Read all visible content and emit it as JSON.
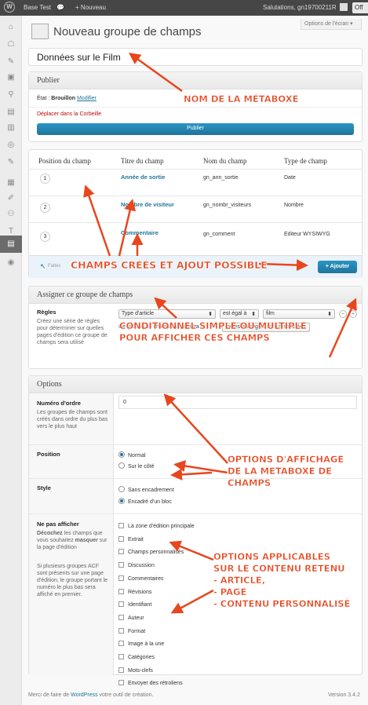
{
  "adminbar": {
    "site": "Base Test",
    "comments": "💬",
    "new": "+ Nouveau",
    "greeting": "Salutations, gn19700211R",
    "off": "Off"
  },
  "screen_options": "Options de l'écran ▾",
  "page_title": "Nouveau groupe de champs",
  "title_value": "Données sur le Film",
  "publish": {
    "heading": "Publier",
    "status_label": "État :",
    "status_value": "Brouillon",
    "edit_link": "Modifier",
    "trash": "Déplacer dans la Corbeille",
    "button": "Publier"
  },
  "fields": {
    "headers": [
      "Position du champ",
      "Titre du champ",
      "Nom du champ",
      "Type de champ"
    ],
    "rows": [
      {
        "pos": "1",
        "title": "Année de sortie",
        "name": "gn_ann_sortie",
        "type": "Date"
      },
      {
        "pos": "2",
        "title": "Nombre de visiteur",
        "name": "gn_nombr_visiteurs",
        "type": "Nombre"
      },
      {
        "pos": "3",
        "title": "Commentaire",
        "name": "gn_comment",
        "type": "Editeur WYSIWYG"
      }
    ],
    "hint": "Faites",
    "add_button": "+ Ajouter"
  },
  "location": {
    "heading": "Assigner ce groupe de champs",
    "rules_label": "Règles",
    "rules_desc": "Créez une série de règles pour déterminer sur quelles pages d'édition ce groupe de champs sera utilisé",
    "param": "Type d'article",
    "operator": "est égal à",
    "value": "film",
    "shown_if": "Ce groupe de champs apparaîtra si :",
    "match": "toutes les règles sont respectées"
  },
  "options": {
    "heading": "Options",
    "order_label": "Numéro d'ordre",
    "order_desc": "Les groupes de champs sont créés dans ordre du plus bas vers le plus haut",
    "order_value": "0",
    "position_label": "Position",
    "position_opts": [
      "Normal",
      "Sur le côté"
    ],
    "style_label": "Style",
    "style_opts": [
      "Sans encadrement",
      "Encadré d'un bloc"
    ],
    "hide_label": "Ne pas afficher",
    "hide_desc1a": "Décochez",
    "hide_desc1b": " les champs que vous souhaitez ",
    "hide_desc1c": "masquer",
    "hide_desc1d": " sur la page d'édition",
    "hide_desc2": "Si plusieurs groupes ACF sont présents sur une page d'édition, le groupe portant le numéro le plus bas sera affiché en premier.",
    "hide_items": [
      "La zone d'édition principale",
      "Extrait",
      "Champs personnalisés",
      "Discussion",
      "Commentaires",
      "Révisions",
      "Identifiant",
      "Auteur",
      "Format",
      "Image à la une",
      "Catégories",
      "Mots-clefs",
      "Envoyer des rétroliens"
    ]
  },
  "footer": {
    "prefix": "Merci de faire de ",
    "link": "WordPress",
    "suffix": " votre outil de création.",
    "version": "Version 3.4.2"
  },
  "annotations": {
    "a1": "NOM DE LA MÉTABOXE",
    "a2": "CHAMPS CRÉÉS ET AJOUT POSSIBLE",
    "a3a": "CONDITIONNEL SIMPLE OU MULTIPLE",
    "a3b": "POUR AFFICHER CES CHAMPS",
    "a4a": "OPTIONS D'AFFICHAGE",
    "a4b": "DE LA METABOXE DE",
    "a4c": "CHAMPS",
    "a5a": "OPTIONS APPLICABLES",
    "a5b": "SUR LE CONTENU RETENU",
    "a5c": "- ARTICLE,",
    "a5d": "- PAGE",
    "a5e": "- CONTENU PERSONNALISÉ"
  },
  "colors": {
    "accent": "#21759b",
    "annotation": "#e8461e",
    "publish_button": "#1f76b4"
  }
}
